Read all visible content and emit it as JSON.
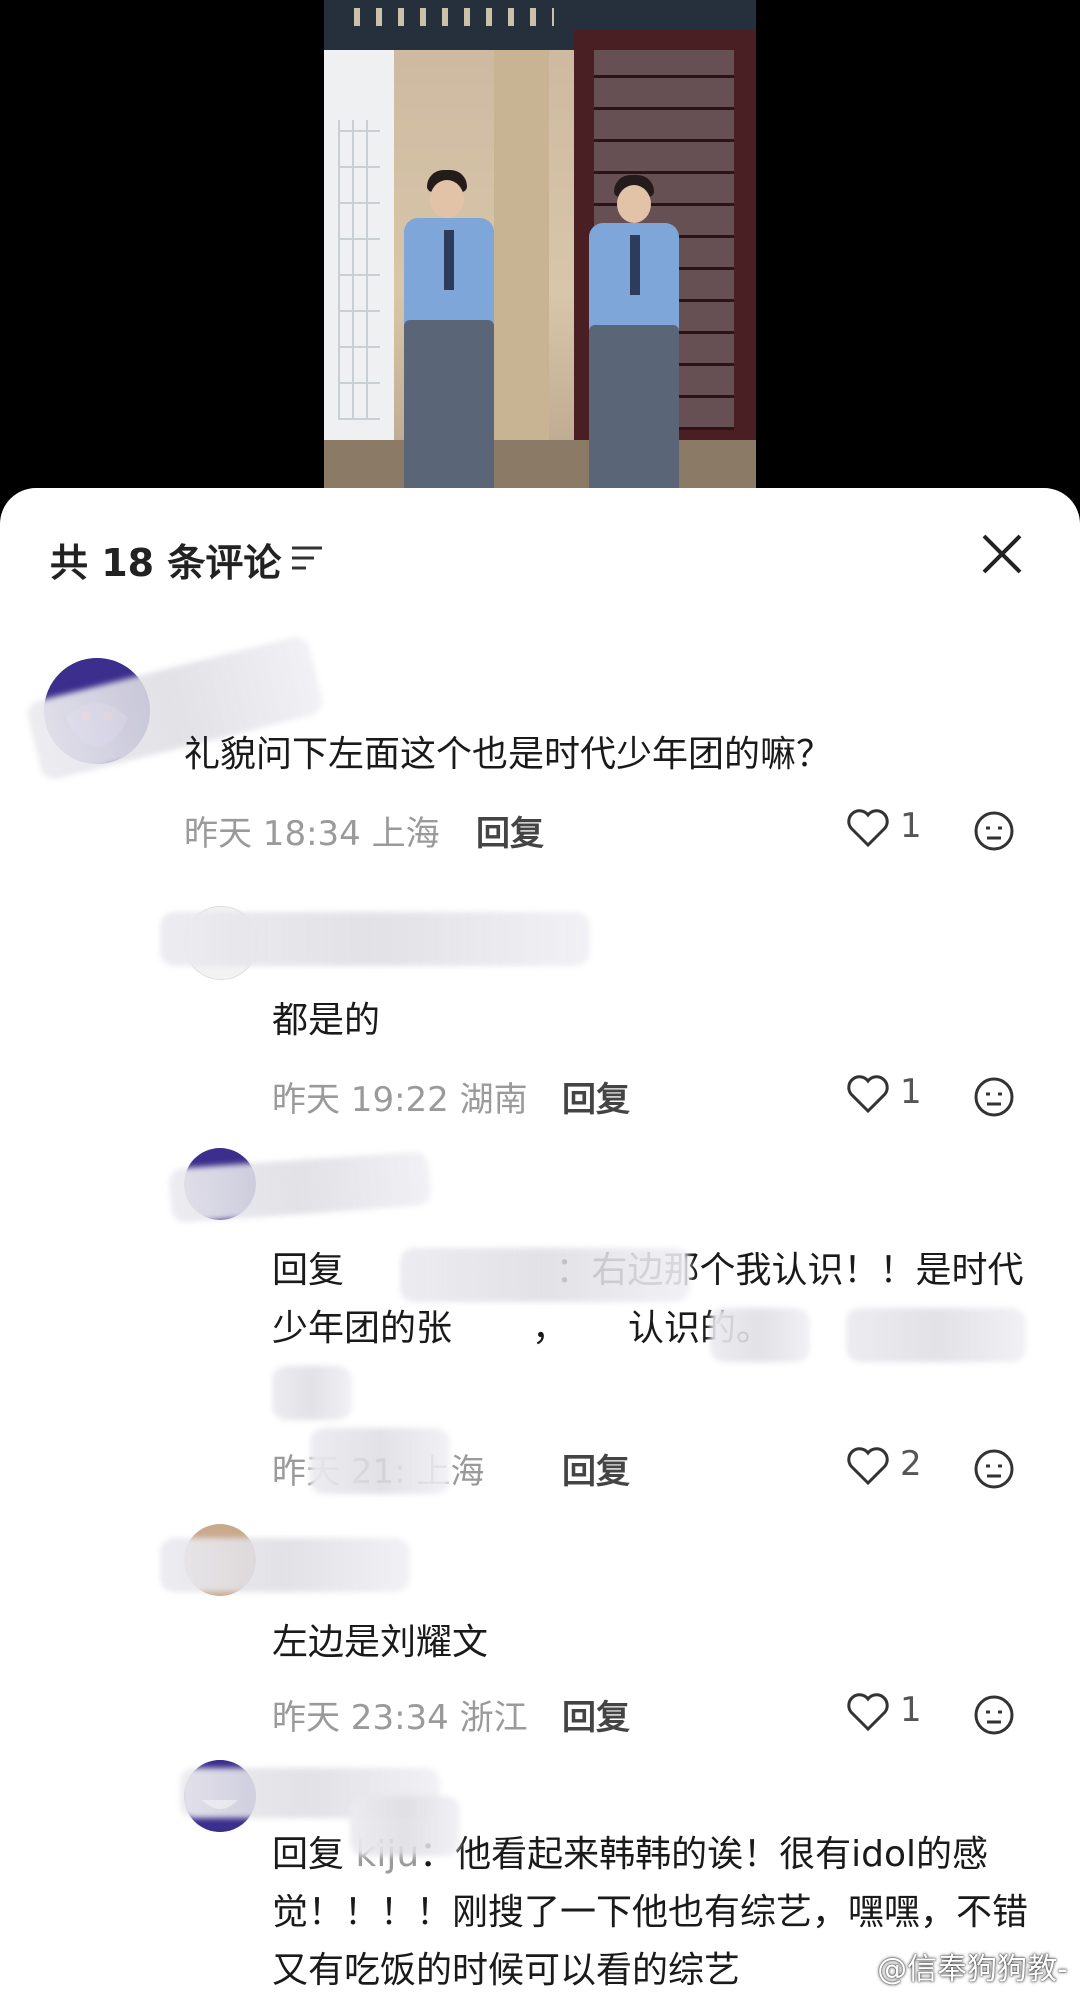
{
  "header": {
    "title": "共 18 条评论"
  },
  "comments": [
    {
      "text": "礼貌问下左面这个也是时代少年团的嘛？",
      "time": "昨天 18:34",
      "location": "上海",
      "reply_label": "回复",
      "likes": "1"
    },
    {
      "text": "都是的",
      "time": "昨天 19:22",
      "location": "湖南",
      "reply_label": "回复",
      "likes": "1"
    },
    {
      "reply_prefix": "回复",
      "text": "：右边那个我认识！！是时代少年团的张",
      "text_cont": "，",
      "text_end": "认识的。",
      "time": "昨天 21:",
      "location": "上海",
      "reply_label": "回复",
      "likes": "2"
    },
    {
      "text": "左边是刘耀文",
      "time": "昨天 23:34",
      "location": "浙江",
      "reply_label": "回复",
      "likes": "1"
    },
    {
      "reply_prefix": "回复",
      "mention": "kiju",
      "text": "：他看起来韩韩的诶！很有idol的感觉！！！！刚搜了一下他也有综艺，",
      "text_tail": "嘿嘿，不错又有吃饭的时候可以看的综艺"
    }
  ],
  "watermark": "@信奉狗狗教-",
  "colors": {
    "accent": "#1a1a1a",
    "meta": "#9a9a9a"
  }
}
